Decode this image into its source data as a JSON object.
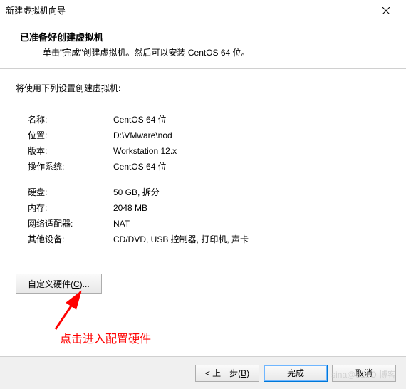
{
  "titlebar": {
    "title": "新建虚拟机向导"
  },
  "header": {
    "heading": "已准备好创建虚拟机",
    "subtext": "单击\"完成\"创建虚拟机。然后可以安装 CentOS 64 位。"
  },
  "settings_label": "将使用下列设置创建虚拟机:",
  "rows": {
    "name_l": "名称:",
    "name_v": "CentOS 64 位",
    "location_l": "位置:",
    "location_v": "D:\\VMware\\nod",
    "version_l": "版本:",
    "version_v": "Workstation 12.x",
    "os_l": "操作系统:",
    "os_v": "CentOS 64 位",
    "disk_l": "硬盘:",
    "disk_v": "50 GB, 拆分",
    "memory_l": "内存:",
    "memory_v": "2048 MB",
    "net_l": "网络适配器:",
    "net_v": "NAT",
    "other_l": "其他设备:",
    "other_v": "CD/DVD, USB 控制器, 打印机, 声卡"
  },
  "customize": {
    "pre": "自定义硬件(",
    "key": "C",
    "post": ")..."
  },
  "annotation": "点击进入配置硬件",
  "footer": {
    "back_pre": "< 上一步(",
    "back_key": "B",
    "back_post": ")",
    "finish": "完成",
    "cancel": "取消"
  },
  "watermark": "sina@51..O 博客"
}
